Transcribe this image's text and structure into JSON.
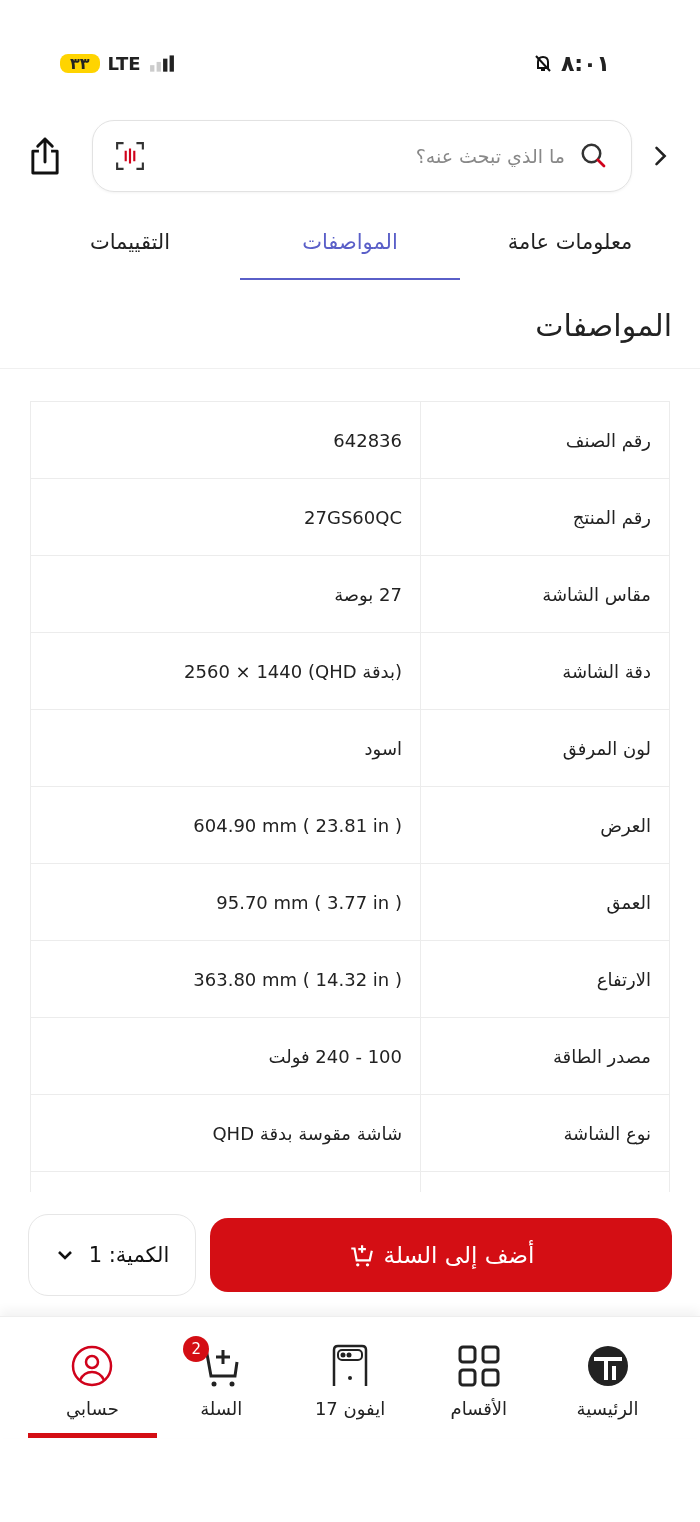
{
  "status_bar": {
    "time": "٨:٠١",
    "network": "LTE",
    "battery": "٣٣"
  },
  "search": {
    "placeholder": "ما الذي تبحث عنه؟"
  },
  "tabs": [
    {
      "label": "معلومات عامة",
      "selected": false
    },
    {
      "label": "المواصفات",
      "selected": true
    },
    {
      "label": "التقييمات",
      "selected": false
    }
  ],
  "section_title": "المواصفات",
  "specs": [
    {
      "label": "رقم الصنف",
      "value": "642836"
    },
    {
      "label": "رقم المنتج",
      "value": "27GS60QC"
    },
    {
      "label": "مقاس الشاشة",
      "value": "27 بوصة"
    },
    {
      "label": "دقة الشاشة",
      "value": "2560 × 1440 (QHD بدقة)"
    },
    {
      "label": "لون المرفق",
      "value": "اسود"
    },
    {
      "label": "العرض",
      "value": "604.90 mm ( 23.81 in )"
    },
    {
      "label": "العمق",
      "value": "95.70 mm ( 3.77 in )"
    },
    {
      "label": "الارتفاع",
      "value": "363.80 mm ( 14.32 in )"
    },
    {
      "label": "مصدر الطاقة",
      "value": "100 - 240 فولت"
    },
    {
      "label": "نوع الشاشة",
      "value": "شاشة مقوسة بدقة QHD"
    }
  ],
  "add_to_cart": "أضف إلى السلة",
  "quantity": "الكمية: 1",
  "nav": [
    {
      "label": "الرئيسية",
      "selected": false
    },
    {
      "label": "الأقسام",
      "selected": false
    },
    {
      "label": "ايفون 17",
      "selected": false
    },
    {
      "label": "السلة",
      "selected": false,
      "badge": "2"
    },
    {
      "label": "حسابي",
      "selected": true
    }
  ]
}
